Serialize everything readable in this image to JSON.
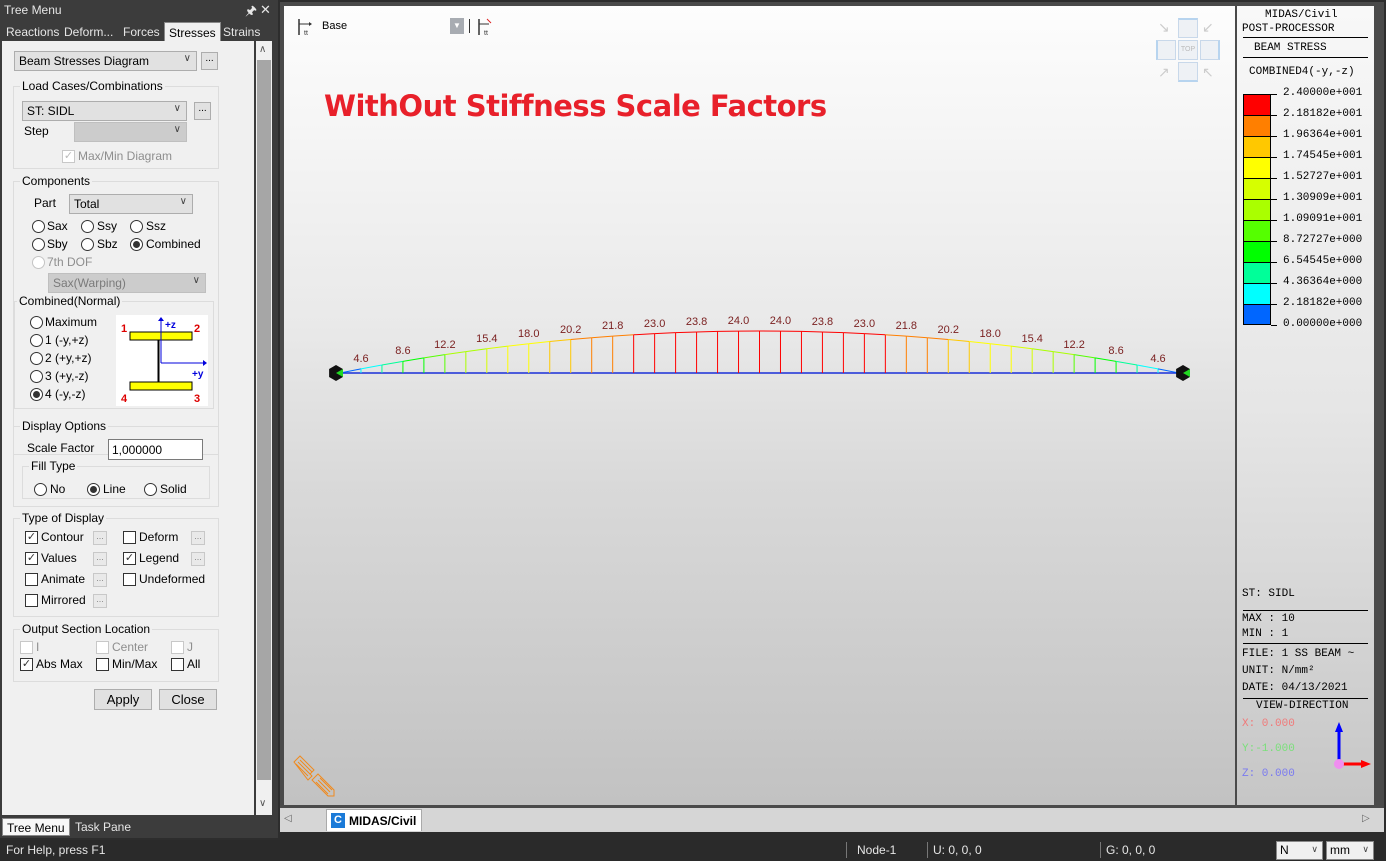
{
  "tree_menu": {
    "title": "Tree Menu",
    "pin_icon": "pin-icon",
    "close_icon": "close-icon",
    "tabs": [
      {
        "label": "Reactions",
        "active": false
      },
      {
        "label": "Deform...",
        "active": false
      },
      {
        "label": "Forces",
        "active": false
      },
      {
        "label": "Stresses",
        "active": true
      },
      {
        "label": "Strains",
        "active": false
      }
    ],
    "diagram_type": "Beam Stresses Diagram",
    "more_label": "...",
    "load_cases": {
      "legend": "Load Cases/Combinations",
      "selected": "ST: SIDL",
      "step_label": "Step",
      "step_value": "",
      "maxmin_label": "Max/Min Diagram",
      "maxmin_checked": true
    },
    "components": {
      "legend": "Components",
      "part_label": "Part",
      "part_value": "Total",
      "radios": [
        {
          "label": "Sax",
          "checked": false
        },
        {
          "label": "Ssy",
          "checked": false
        },
        {
          "label": "Ssz",
          "checked": false
        },
        {
          "label": "Sby",
          "checked": false
        },
        {
          "label": "Sbz",
          "checked": false
        },
        {
          "label": "Combined",
          "checked": true
        }
      ],
      "seventh_dof_label": "7th DOF",
      "warping_value": "Sax(Warping)",
      "combined": {
        "legend": "Combined(Normal)",
        "options": [
          {
            "label": "Maximum",
            "checked": false
          },
          {
            "label": "1 (-y,+z)",
            "checked": false
          },
          {
            "label": "2 (+y,+z)",
            "checked": false
          },
          {
            "label": "3 (+y,-z)",
            "checked": false
          },
          {
            "label": "4 (-y,-z)",
            "checked": true
          }
        ],
        "section_labels": {
          "p1": "1",
          "p2": "2",
          "p3": "3",
          "p4": "4",
          "z": "+z",
          "y": "+y"
        }
      }
    },
    "display_options": {
      "legend": "Display Options",
      "scale_factor_label": "Scale Factor",
      "scale_factor_value": "1,000000",
      "fill_type_legend": "Fill Type",
      "fill_types": [
        {
          "label": "No",
          "checked": false
        },
        {
          "label": "Line",
          "checked": true
        },
        {
          "label": "Solid",
          "checked": false
        }
      ]
    },
    "type_of_display": {
      "legend": "Type of Display",
      "items": [
        {
          "label": "Contour",
          "checked": true,
          "has_more": true
        },
        {
          "label": "Deform",
          "checked": false,
          "has_more": true
        },
        {
          "label": "Values",
          "checked": true,
          "has_more": true
        },
        {
          "label": "Legend",
          "checked": true,
          "has_more": true
        },
        {
          "label": "Animate",
          "checked": false,
          "has_more": true
        },
        {
          "label": "Undeformed",
          "checked": false,
          "has_more": false
        },
        {
          "label": "Mirrored",
          "checked": false,
          "has_more": true
        }
      ]
    },
    "output_section": {
      "legend": "Output Section Location",
      "items": [
        {
          "label": "I",
          "checked": false,
          "disabled": true
        },
        {
          "label": "Center",
          "checked": false,
          "disabled": true
        },
        {
          "label": "J",
          "checked": false,
          "disabled": true
        },
        {
          "label": "Abs Max",
          "checked": true,
          "disabled": false
        },
        {
          "label": "Min/Max",
          "checked": false,
          "disabled": false
        },
        {
          "label": "All",
          "checked": false,
          "disabled": false
        }
      ]
    },
    "apply_label": "Apply",
    "close_label": "Close",
    "bottom_tabs": [
      {
        "label": "Tree Menu",
        "active": true
      },
      {
        "label": "Task Pane",
        "active": false
      }
    ]
  },
  "viewport": {
    "story_label": "Base",
    "annotation": "WithOut Stiffness Scale Factors",
    "annotation_color": "#e8202a",
    "view_cube_label": "TOP",
    "beam_values": [
      "4.6",
      "8.6",
      "12.2",
      "15.4",
      "18.0",
      "20.2",
      "21.8",
      "23.0",
      "23.8",
      "24.0",
      "24.0",
      "23.8",
      "23.0",
      "21.8",
      "20.2",
      "18.0",
      "15.4",
      "12.2",
      "8.6",
      "4.6"
    ]
  },
  "legend_panel": {
    "title1": "MIDAS/Civil",
    "title2": "POST-PROCESSOR",
    "result_type": "BEAM STRESS",
    "component": "COMBINED4(-y,-z)",
    "scale": [
      {
        "value": "2.40000e+001",
        "color": "#ff0000"
      },
      {
        "value": "2.18182e+001",
        "color": "#ff7f00"
      },
      {
        "value": "1.96364e+001",
        "color": "#ffc800"
      },
      {
        "value": "1.74545e+001",
        "color": "#ffff00"
      },
      {
        "value": "1.52727e+001",
        "color": "#d6ff00"
      },
      {
        "value": "1.30909e+001",
        "color": "#aaff00"
      },
      {
        "value": "1.09091e+001",
        "color": "#55ff00"
      },
      {
        "value": "8.72727e+000",
        "color": "#00ff00"
      },
      {
        "value": "6.54545e+000",
        "color": "#00ff99"
      },
      {
        "value": "4.36364e+000",
        "color": "#00ffff"
      },
      {
        "value": "2.18182e+000",
        "color": "#0066ff"
      },
      {
        "value": "0.00000e+000",
        "color": null
      }
    ],
    "load_case": "ST: SIDL",
    "max": "MAX : 10",
    "min": "MIN : 1",
    "file": "FILE: 1 SS BEAM ~",
    "unit": "UNIT: N/mm²",
    "date": "DATE: 04/13/2021",
    "view_direction_label": "VIEW-DIRECTION",
    "x": "X: 0.000",
    "y": "Y:-1.000",
    "z": "Z: 0.000"
  },
  "doc_tabs": {
    "active_tab": "MIDAS/Civil"
  },
  "status_bar": {
    "help": "For Help, press F1",
    "node": "Node-1",
    "u": "U: 0, 0, 0",
    "g": "G: 0, 0, 0",
    "force_unit": "N",
    "length_unit": "mm"
  }
}
